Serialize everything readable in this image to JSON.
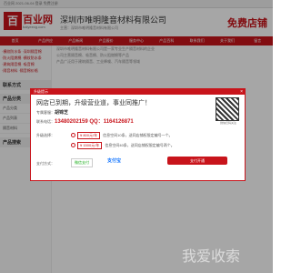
{
  "topbar": {
    "text": "百业网  2021-06-04  登录  免费注册"
  },
  "header": {
    "logo_char": "百",
    "logo_text": "百业网",
    "logo_sub": "baiyeexg.com",
    "company": "深圳市唯明隆音材料有限公司",
    "company_sub": "主营：深圳市唯明隆音材料有限公司",
    "freeshop": "免费店铺"
  },
  "nav": [
    "首页",
    "产品供应",
    "产品新闻",
    "产品报价",
    "服务中心",
    "产品百科",
    "联系我们",
    "关于我们",
    "留言"
  ],
  "left": {
    "links": [
      "·横纹防水条 ·深圳隔音棉",
      "·防火阻燃棉 ·横纹防水条",
      "·建筑隔音棉 ·吸音棉",
      "·隔音材料 ·隔音棉价格"
    ],
    "section1": "联系方式",
    "section2": "产品分类",
    "section3": "产品搜索",
    "items": [
      "产品分类",
      "产品列表",
      "隔音材料"
    ]
  },
  "right": {
    "lines": [
      "深圳市唯明隆音材料有限公司是一家专业生产隔音材料的企业",
      "公司主营隔音棉、吸音棉、防火阻燃棉等产品",
      "产品广泛用于建筑隔音、工业降噪、汽车隔音等领域"
    ]
  },
  "modal": {
    "head": "升级提示",
    "close": "×",
    "title": "网店已到期，升级营业道，事业同推广！",
    "contact_label": "专属客服：",
    "contact_name": "胡锦芝",
    "phone_label": "联系电话：",
    "phone": "13480202159 QQ：1164126871",
    "qr_caption": "微信扫码关注",
    "upgrade_label": "升级选择：",
    "options": [
      {
        "price": "¥ 800元/年",
        "desc": "信息空间10条，送同店铺权限定编号一个。"
      },
      {
        "price": "¥ 1500元/年",
        "desc": "信息空间40条，送同店铺权限定编号两个。"
      }
    ],
    "pay_label": "支付方式：",
    "pay_wechat": "微信支付",
    "pay_alipay": "支付宝",
    "pay_button": "支付开通"
  },
  "watermark": "我爱收索",
  "colors": {
    "brand_red": "#c8141b",
    "wechat_green": "#1aad19",
    "alipay_blue": "#1677ff"
  }
}
